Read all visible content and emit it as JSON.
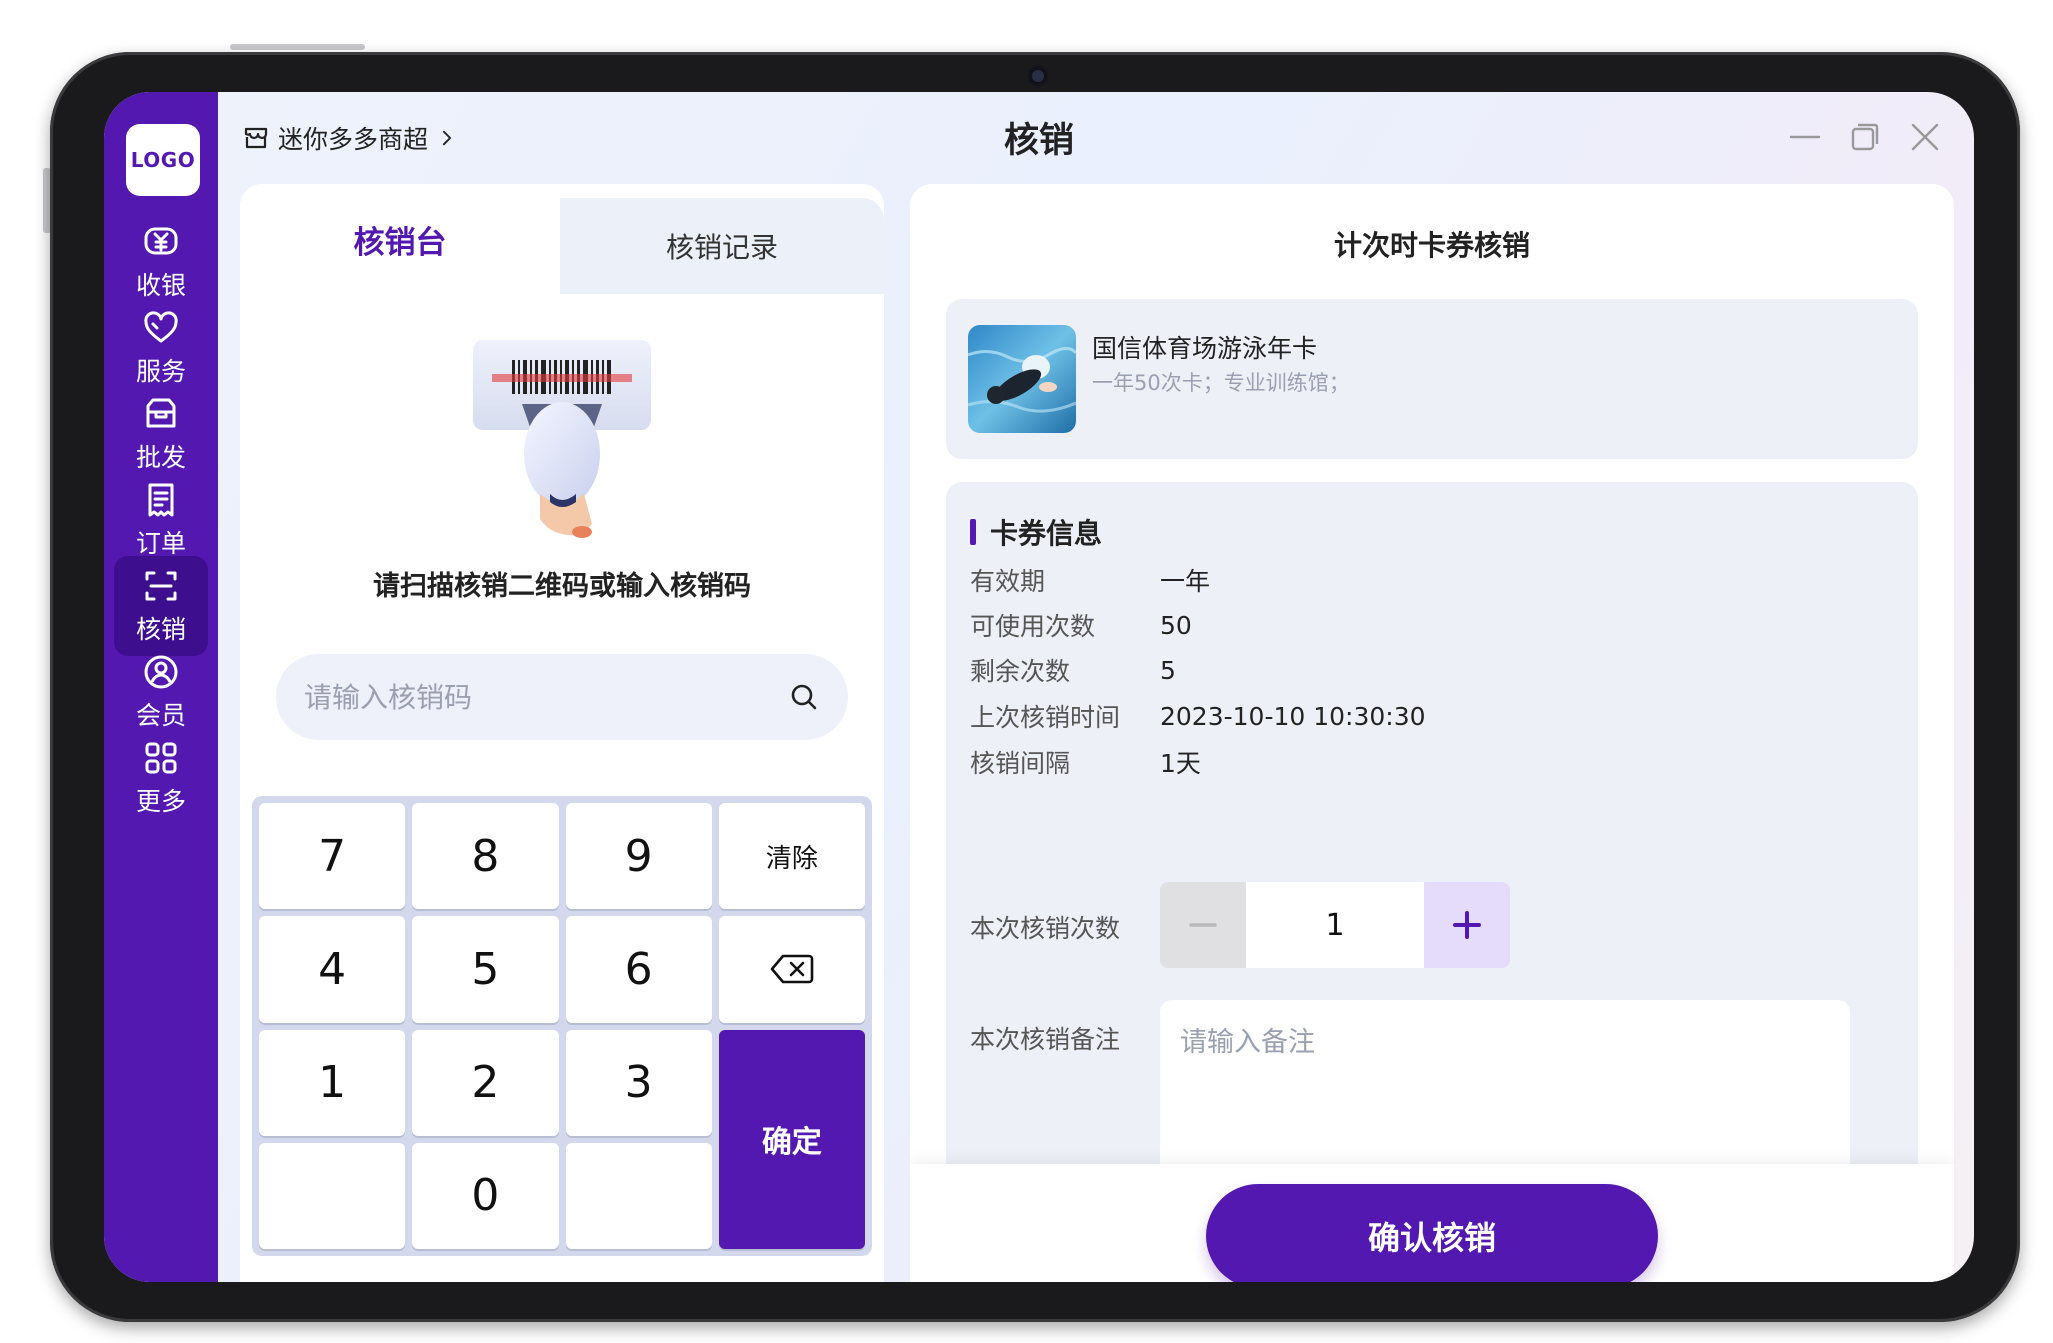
{
  "sidebar": {
    "logo": "LOGO",
    "items": [
      {
        "label": "收银",
        "icon": "yuan-icon"
      },
      {
        "label": "服务",
        "icon": "heart-icon"
      },
      {
        "label": "批发",
        "icon": "box-icon"
      },
      {
        "label": "订单",
        "icon": "order-icon"
      },
      {
        "label": "核销",
        "icon": "scan-icon",
        "active": true
      },
      {
        "label": "会员",
        "icon": "user-icon"
      },
      {
        "label": "更多",
        "icon": "grid-icon"
      }
    ]
  },
  "header": {
    "store_name": "迷你多多商超",
    "title": "核销"
  },
  "left": {
    "tabs": [
      {
        "label": "核销台",
        "active": true
      },
      {
        "label": "核销记录",
        "active": false
      }
    ],
    "prompt": "请扫描核销二维码或输入核销码",
    "search_placeholder": "请输入核销码",
    "keypad": {
      "k7": "7",
      "k8": "8",
      "k9": "9",
      "clear": "清除",
      "k4": "4",
      "k5": "5",
      "k6": "6",
      "k1": "1",
      "k2": "2",
      "k3": "3",
      "confirm": "确定",
      "k0": "0"
    }
  },
  "right": {
    "title": "计次时卡券核销",
    "card": {
      "name": "国信体育场游泳年卡",
      "desc": "一年50次卡；专业训练馆；"
    },
    "section_title": "卡券信息",
    "rows": [
      {
        "label": "有效期",
        "value": "一年"
      },
      {
        "label": "可使用次数",
        "value": "50"
      },
      {
        "label": "剩余次数",
        "value": "5"
      },
      {
        "label": "上次核销时间",
        "value": "2023-10-10 10:30:30"
      },
      {
        "label": "核销间隔",
        "value": "1天"
      }
    ],
    "count_label": "本次核销次数",
    "count_value": "1",
    "note_label": "本次核销备注",
    "note_placeholder": "请输入备注",
    "confirm_label": "确认核销"
  },
  "colors": {
    "brand": "#5218b0",
    "brand_dark": "#3d0e8d",
    "panel_bg": "#eef0f8"
  }
}
